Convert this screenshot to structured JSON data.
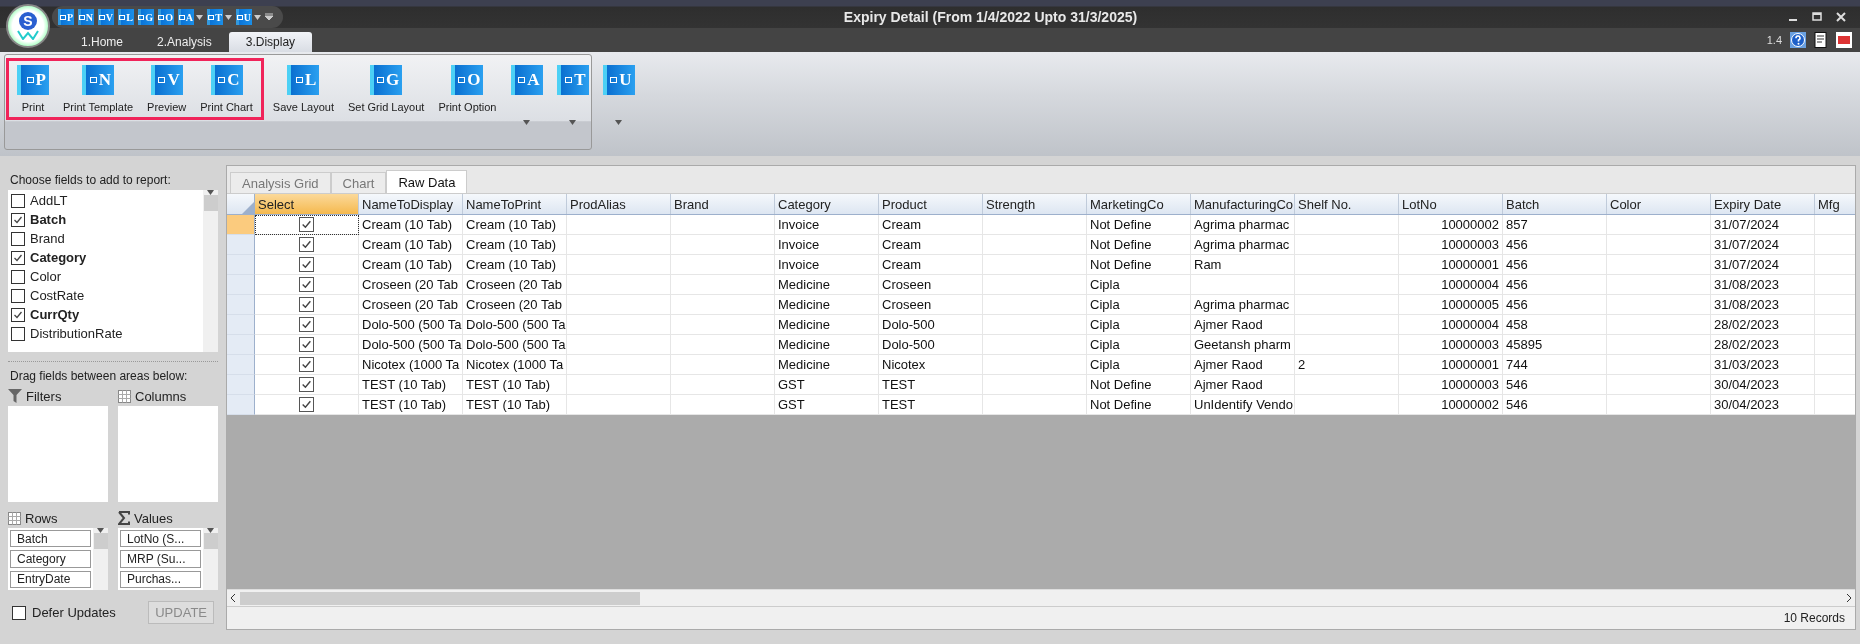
{
  "window": {
    "title": "Expiry Detail (From 1/4/2022 Upto 31/3/2025)",
    "logo_text": "S"
  },
  "quick_access": [
    {
      "letter": "P",
      "dropdown": false
    },
    {
      "letter": "N",
      "dropdown": false
    },
    {
      "letter": "V",
      "dropdown": false
    },
    {
      "letter": "L",
      "dropdown": false
    },
    {
      "letter": "G",
      "dropdown": false
    },
    {
      "letter": "O",
      "dropdown": false
    },
    {
      "letter": "A",
      "dropdown": true
    },
    {
      "letter": "T",
      "dropdown": true
    },
    {
      "letter": "U",
      "dropdown": true
    }
  ],
  "ribbon_tabs": [
    {
      "label": "1.Home",
      "selected": false
    },
    {
      "label": "2.Analysis",
      "selected": false
    },
    {
      "label": "3.Display",
      "selected": true
    }
  ],
  "version": "1.4",
  "ribbon_groups": [
    {
      "highlighted": true,
      "buttons": [
        {
          "letter": "P",
          "label": "Print"
        },
        {
          "letter": "N",
          "label": "Print Template"
        },
        {
          "letter": "V",
          "label": "Preview"
        },
        {
          "letter": "C",
          "label": "Print Chart"
        }
      ]
    },
    {
      "buttons": [
        {
          "letter": "L",
          "label": "Save Layout"
        },
        {
          "letter": "G",
          "label": "Set Grid Layout"
        },
        {
          "letter": "O",
          "label": "Print Option"
        }
      ]
    },
    {
      "buttons": [
        {
          "letter": "A",
          "dropdown": true
        },
        {
          "letter": "T",
          "dropdown": true
        },
        {
          "letter": "U",
          "dropdown": true
        }
      ]
    }
  ],
  "field_list": {
    "title": "Choose fields to add to report:",
    "items": [
      {
        "label": "AddLT",
        "checked": false
      },
      {
        "label": "Batch",
        "checked": true
      },
      {
        "label": "Brand",
        "checked": false
      },
      {
        "label": "Category",
        "checked": true
      },
      {
        "label": "Color",
        "checked": false
      },
      {
        "label": "CostRate",
        "checked": false
      },
      {
        "label": "CurrQty",
        "checked": true
      },
      {
        "label": "DistributionRate",
        "checked": false
      }
    ]
  },
  "areas_title": "Drag fields between areas below:",
  "areas": [
    {
      "kind": "filter",
      "label": "Filters"
    },
    {
      "kind": "columns",
      "label": "Columns"
    },
    {
      "kind": "rows",
      "label": "Rows",
      "items": [
        "Batch",
        "Category",
        "EntryDate"
      ]
    },
    {
      "kind": "values",
      "label": "Values",
      "items": [
        "LotNo (S...",
        "MRP (Su...",
        "Purchas..."
      ]
    }
  ],
  "defer_updates": {
    "label": "Defer Updates",
    "checked": false
  },
  "update_button": {
    "label": "UPDATE",
    "disabled": true
  },
  "view_tabs": [
    {
      "label": "Analysis Grid",
      "selected": false
    },
    {
      "label": "Chart",
      "selected": false
    },
    {
      "label": "Raw Data",
      "selected": true
    }
  ],
  "table": {
    "columns": [
      "Select",
      "NameToDisplay",
      "NameToPrint",
      "ProdAlias",
      "Brand",
      "Category",
      "Product",
      "Strength",
      "MarketingCo",
      "ManufacturingCo",
      "Shelf No.",
      "LotNo",
      "Batch",
      "Color",
      "Expiry Date",
      "Mfg"
    ],
    "rows": [
      {
        "selected": true,
        "checked": true,
        "name_to_display": "Cream (10 Tab)",
        "name_to_print": "Cream (10 Tab)",
        "category": "Invoice",
        "product": "Cream",
        "marketing_co": "Not Define",
        "manufacturing_co": "Agrima pharmac",
        "lot_no": "10000002",
        "batch": "857",
        "expiry_date": "31/07/2024"
      },
      {
        "selected": false,
        "checked": true,
        "name_to_display": "Cream (10 Tab)",
        "name_to_print": "Cream (10 Tab)",
        "category": "Invoice",
        "product": "Cream",
        "marketing_co": "Not Define",
        "manufacturing_co": "Agrima pharmac",
        "lot_no": "10000003",
        "batch": "456",
        "expiry_date": "31/07/2024"
      },
      {
        "selected": false,
        "checked": true,
        "name_to_display": "Cream (10 Tab)",
        "name_to_print": "Cream (10 Tab)",
        "category": "Invoice",
        "product": "Cream",
        "marketing_co": "Not Define",
        "manufacturing_co": "Ram",
        "lot_no": "10000001",
        "batch": "456",
        "expiry_date": "31/07/2024"
      },
      {
        "selected": false,
        "checked": true,
        "name_to_display": "Croseen (20 Tab",
        "name_to_print": "Croseen (20 Tab",
        "category": "Medicine",
        "product": "Croseen",
        "marketing_co": "Cipla",
        "lot_no": "10000004",
        "batch": "456",
        "expiry_date": "31/08/2023"
      },
      {
        "selected": false,
        "checked": true,
        "name_to_display": "Croseen (20 Tab",
        "name_to_print": "Croseen (20 Tab",
        "category": "Medicine",
        "product": "Croseen",
        "marketing_co": "Cipla",
        "manufacturing_co": "Agrima pharmac",
        "lot_no": "10000005",
        "batch": "456",
        "expiry_date": "31/08/2023"
      },
      {
        "selected": false,
        "checked": true,
        "name_to_display": "Dolo-500 (500 Ta",
        "name_to_print": "Dolo-500 (500 Ta",
        "category": "Medicine",
        "product": "Dolo-500",
        "marketing_co": "Cipla",
        "manufacturing_co": "Ajmer Raod",
        "lot_no": "10000004",
        "batch": "458",
        "expiry_date": "28/02/2023"
      },
      {
        "selected": false,
        "checked": true,
        "name_to_display": "Dolo-500 (500 Ta",
        "name_to_print": "Dolo-500 (500 Ta",
        "category": "Medicine",
        "product": "Dolo-500",
        "marketing_co": "Cipla",
        "manufacturing_co": "Geetansh pharm",
        "lot_no": "10000003",
        "batch": "45895",
        "expiry_date": "28/02/2023"
      },
      {
        "selected": false,
        "checked": true,
        "name_to_display": "Nicotex (1000 Ta",
        "name_to_print": "Nicotex (1000 Ta",
        "category": "Medicine",
        "product": "Nicotex",
        "marketing_co": "Cipla",
        "manufacturing_co": "Ajmer Raod",
        "shelf_no": "2",
        "lot_no": "10000001",
        "batch": "744",
        "expiry_date": "31/03/2023"
      },
      {
        "selected": false,
        "checked": true,
        "name_to_display": "TEST (10 Tab)",
        "name_to_print": "TEST (10 Tab)",
        "category": "GST",
        "product": "TEST",
        "marketing_co": "Not Define",
        "manufacturing_co": "Ajmer Raod",
        "lot_no": "10000003",
        "batch": "546",
        "expiry_date": "30/04/2023"
      },
      {
        "selected": false,
        "checked": true,
        "name_to_display": "TEST (10 Tab)",
        "name_to_print": "TEST (10 Tab)",
        "category": "GST",
        "product": "TEST",
        "marketing_co": "Not Define",
        "manufacturing_co": "UnIdentify Vendo",
        "lot_no": "10000002",
        "batch": "546",
        "expiry_date": "30/04/2023"
      }
    ]
  },
  "status_bar": {
    "records": "10 Records"
  }
}
